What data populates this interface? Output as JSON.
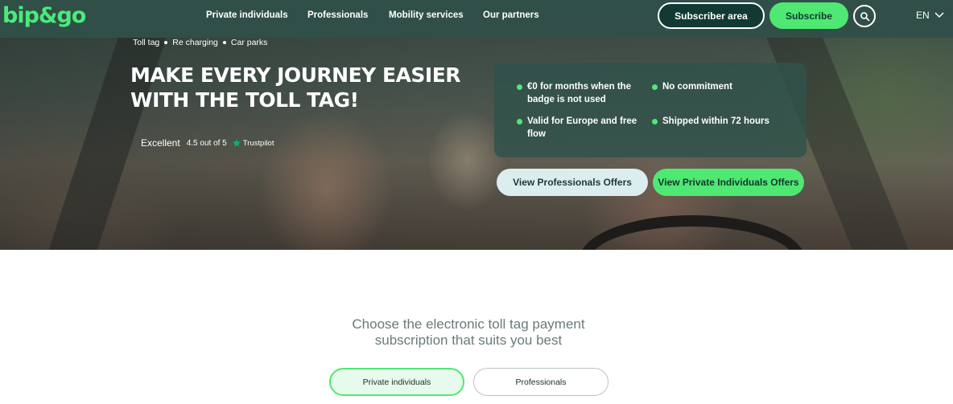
{
  "brand": {
    "logo_text": "bip&go",
    "accent_color": "#4fe873",
    "header_color": "#314f48"
  },
  "nav": {
    "items": [
      {
        "label": "Private individuals"
      },
      {
        "label": "Professionals"
      },
      {
        "label": "Mobility services"
      },
      {
        "label": "Our partners"
      }
    ],
    "subscriber_area_label": "Subscriber area",
    "subscribe_label": "Subscribe",
    "search_icon": "search-icon",
    "language": "EN",
    "language_icon": "chevron-down-icon"
  },
  "breadcrumb": [
    "Toll tag",
    "Re charging",
    "Car parks"
  ],
  "hero": {
    "headline_line1": "Make every journey easier",
    "headline_line2": "with the toll tag!",
    "rating": {
      "word": "Excellent",
      "score": "4.5 out of 5",
      "provider": "Trustpilot",
      "icon": "star-icon"
    },
    "benefits": [
      {
        "line1": "€0 for months when the",
        "line2": "badge is not used"
      },
      {
        "line1": "No commitment",
        "line2": ""
      },
      {
        "line1": "Valid for Europe and free",
        "line2": "flow"
      },
      {
        "line1": "Shipped within 72 hours",
        "line2": ""
      }
    ],
    "pro_offers_label": "View Professionals Offers",
    "private_offers_label": "View Private Individuals Offers"
  },
  "section": {
    "heading_line1": "Choose the electronic toll tag payment",
    "heading_line2": "subscription that suits you best",
    "tabs": [
      {
        "label": "Private individuals",
        "active": true
      },
      {
        "label": "Professionals",
        "active": false
      }
    ]
  }
}
